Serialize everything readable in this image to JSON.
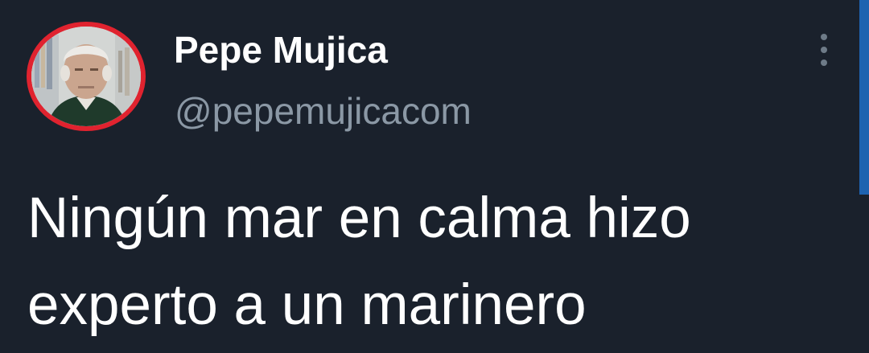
{
  "user": {
    "display_name": "Pepe Mujica",
    "handle": "@pepemujicacom",
    "avatar_icon": "profile-photo",
    "avatar_ring_color": "#e0232f"
  },
  "tweet": {
    "text": "Ningún mar en calma hizo\nexperto a un marinero"
  },
  "menu": {
    "icon": "vertical-ellipsis-icon"
  },
  "theme": {
    "background": "#1a212c",
    "name_color": "#ffffff",
    "handle_color": "#8b98a5",
    "accent": "#1e63b0"
  }
}
